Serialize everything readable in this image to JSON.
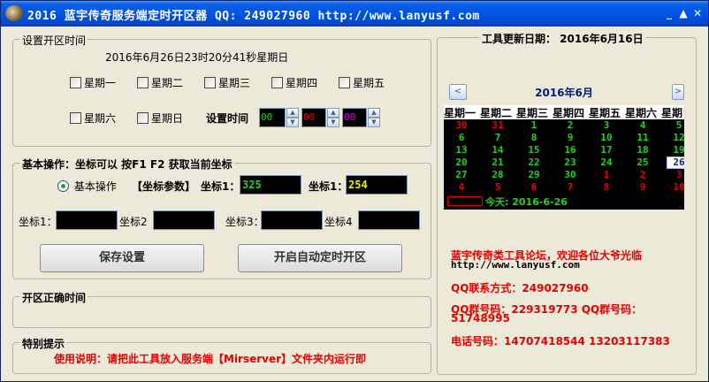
{
  "window": {
    "title": "2016 蓝宇传奇服务端定时开区器 QQ: 249027960 http://www.lanyusf.com",
    "minimize": "_",
    "maximize": "▲",
    "close": "✕"
  },
  "schedule": {
    "group_title": "设置开区时间",
    "current_datetime": "2016年6月26日23时20分41秒星期日",
    "days": [
      {
        "label": "星期一",
        "checked": false
      },
      {
        "label": "星期二",
        "checked": false
      },
      {
        "label": "星期三",
        "checked": false
      },
      {
        "label": "星期四",
        "checked": false
      },
      {
        "label": "星期五",
        "checked": false
      },
      {
        "label": "星期六",
        "checked": false
      },
      {
        "label": "星期日",
        "checked": false
      }
    ],
    "set_time_label": "设置时间",
    "hour": "00",
    "minute": "00",
    "second": "00",
    "colors": {
      "hour": "#21d321",
      "minute": "#e60000",
      "second": "#e000e0"
    }
  },
  "basic": {
    "group_title": "基本操作：坐标可以 按F1  F2 获取当前坐标",
    "radio_label": "基本操作",
    "param_label": "【坐标参数】",
    "coord1_label": "坐标1：",
    "coord1_value": "325",
    "coord1b_label": "坐标1：",
    "coord1b_value": "254",
    "coord_labels": [
      "坐标1：",
      "坐标2",
      "坐标3：",
      "坐标4"
    ],
    "save_button": "保存设置",
    "start_button": "开启自动定时开区"
  },
  "open_time": {
    "group_title": "开区正确时间"
  },
  "notice": {
    "group_title": "特别提示",
    "text": "使用说明：请把此工具放入服务端【Mirserver】文件夹内运行即"
  },
  "update": {
    "group_title": "工具更新日期： 2016年6月16日"
  },
  "calendar": {
    "month_label": "2016年6月",
    "prev": "<",
    "next": ">",
    "weekdays": [
      "星期一",
      "星期二",
      "星期三",
      "星期四",
      "星期五",
      "星期六",
      "星期日"
    ],
    "weeks": [
      [
        "30",
        "31",
        "1",
        "2",
        "3",
        "4",
        "5"
      ],
      [
        "6",
        "7",
        "8",
        "9",
        "10",
        "11",
        "12"
      ],
      [
        "13",
        "14",
        "15",
        "16",
        "17",
        "18",
        "19"
      ],
      [
        "20",
        "21",
        "22",
        "23",
        "24",
        "25",
        "26"
      ],
      [
        "27",
        "28",
        "29",
        "30",
        "1",
        "2",
        "3"
      ],
      [
        "4",
        "5",
        "6",
        "7",
        "8",
        "9",
        "10"
      ]
    ],
    "today_label": "今天: 2016-6-26",
    "selected": "26",
    "colors": {
      "current": "#21d321",
      "other": "#e60000",
      "weekday_bar": "#ffffff"
    }
  },
  "info": {
    "forum": "蓝宇传奇类工具论坛，欢迎各位大爷光临",
    "url": "http://www.lanyusf.com",
    "qq_contact": "QQ联系方式：249027960",
    "qq_group_a": "QQ群号码：229319773   QQ群号码：",
    "qq_group_b": "51748995",
    "phone": "电话号码：14707418544   13203117383"
  }
}
